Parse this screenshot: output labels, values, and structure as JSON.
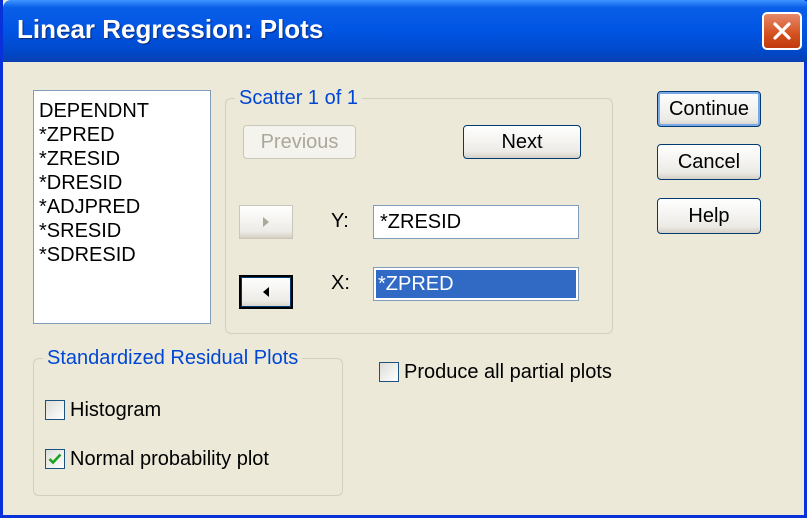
{
  "window": {
    "title": "Linear Regression: Plots"
  },
  "variables": [
    "DEPENDNT",
    "*ZPRED",
    "*ZRESID",
    "*DRESID",
    "*ADJPRED",
    "*SRESID",
    "*SDRESID"
  ],
  "scatter": {
    "legend": "Scatter 1 of 1",
    "previous_label": "Previous",
    "next_label": "Next",
    "y_label": "Y:",
    "y_value": "*ZRESID",
    "x_label": "X:",
    "x_value": "*ZPRED"
  },
  "buttons": {
    "continue": "Continue",
    "cancel": "Cancel",
    "help": "Help"
  },
  "residual_plots": {
    "legend": "Standardized Residual Plots",
    "histogram": {
      "label": "Histogram",
      "checked": false
    },
    "normal_probability": {
      "label": "Normal probability plot",
      "checked": true
    }
  },
  "partial_plots": {
    "label": "Produce all partial plots",
    "checked": false
  },
  "colors": {
    "titlebar": "#0054e3",
    "close": "#d4501d",
    "accent_text": "#0046d5",
    "selection": "#316ac5",
    "check": "#21a121"
  }
}
